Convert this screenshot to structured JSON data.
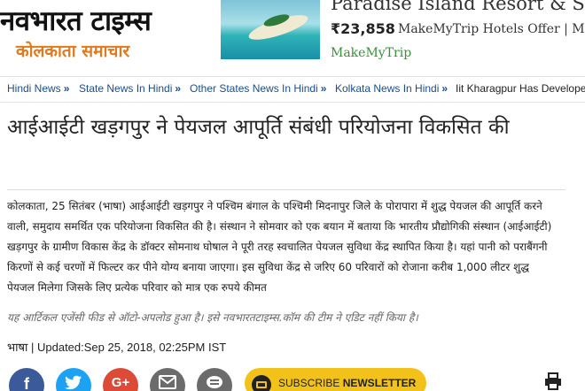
{
  "header": {
    "logo_main": "नवभारत टाइम्स",
    "logo_sub": "कोलकाता समाचार"
  },
  "ad": {
    "title": "Paradise Island Resort & S",
    "price": "₹23,858",
    "offer": "MakeMyTrip Hotels Offer | Mal",
    "brand": "MakeMyTrip"
  },
  "breadcrumb": [
    {
      "label": "Hindi News"
    },
    {
      "label": "State News In Hindi"
    },
    {
      "label": "Other States News In Hindi"
    },
    {
      "label": "Kolkata News In Hindi"
    },
    {
      "label": "Iit Kharagpur Has Develope"
    }
  ],
  "article": {
    "headline": "आईआईटी खड़गपुर ने पेयजल आपूर्ति संबंधी परियोजना विकसित की",
    "body": "कोलकाता, 25 सितंबर (भाषा) आईआईटी खड़गपुर ने पश्चिम बंगाल के पश्चिमी मिदनापुर जिले के पोरापारा में शुद्ध पेयजल की आपूर्ति करने वाली, समुदाय समर्थित एक परियोजना विकसित की है। संस्थान ने सोमवार को एक बयान में बताया कि भारतीय प्रौद्योगिकी संस्थान (आईआईटी) खड़गपुर के ग्रामीण विकास केंद्र के डॉक्टर सोमनाथ घोषाल ने पूरी तरह स्वचालित पेयजल सुविधा केंद्र स्थापित किया है। यहां पानी को पराबैंगनी किरणों से कई चरणों में फिल्टर कर पीने योग्य बनाया जाएगा। इस सुविधा केंद्र से जरिए 60 परिवारों को रोजाना करीब 1,000 लीटर शुद्ध पेयजल मिलेगा जिसके लिए प्रत्येक परिवार को मात्र एक रुपये कीमत",
    "disclaimer": "यह आर्टिकल एजेंसी फीड से ऑटो-अपलोड हुआ है। इसे नवभारतटाइम्स.कॉम की टीम ने एडिट नहीं किया है।",
    "byline": "भाषा | Updated:Sep 25, 2018, 02:25PM IST"
  },
  "share": {
    "facebook_glyph": "f",
    "twitter_glyph": "t",
    "gplus_glyph": "G+",
    "subscribe_prefix": "SUBSCRIBE ",
    "subscribe_bold": "NEWSLETTER"
  },
  "colors": {
    "link": "#1a4d8f",
    "logo_sub": "#e07a1f",
    "facebook": "#3b5a99",
    "twitter": "#1da1f2",
    "gplus": "#dc4a38",
    "subscribe": "#f2c21b"
  }
}
